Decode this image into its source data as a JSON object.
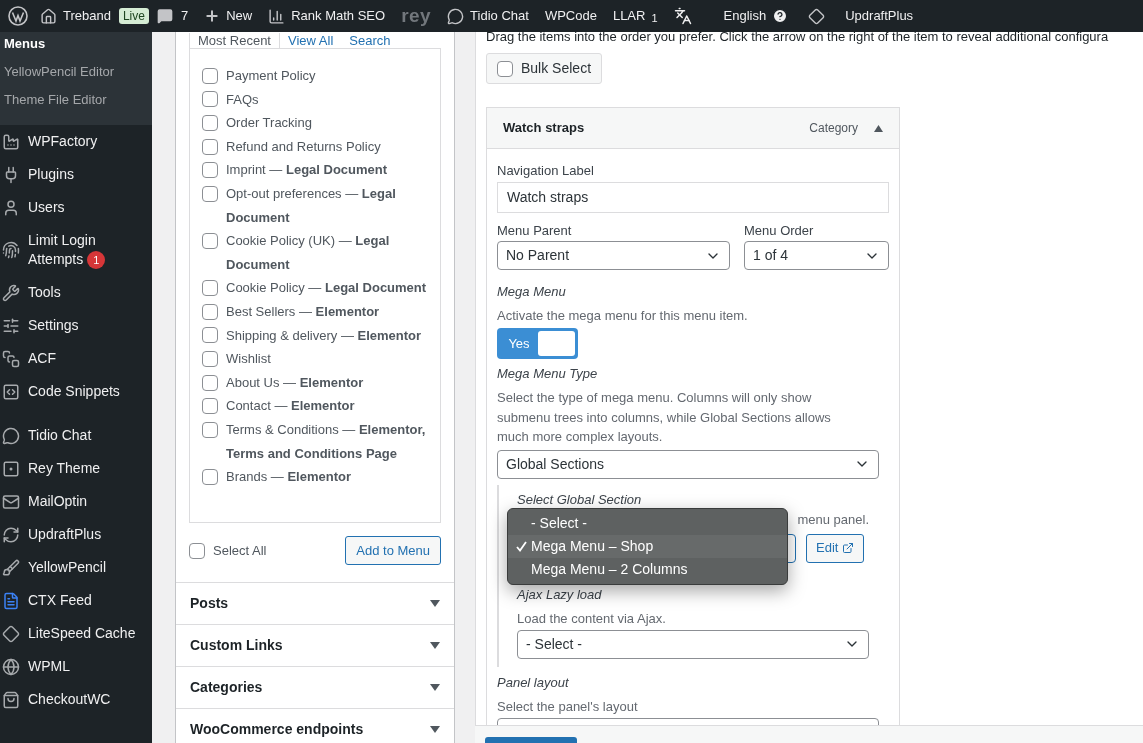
{
  "admin_bar": {
    "site_name": "Treband",
    "site_badge": "Live",
    "comments": "7",
    "new_label": "New",
    "items": [
      {
        "kind": "chart",
        "label": "Rank Math SEO"
      },
      {
        "kind": "logo",
        "label": "rey"
      },
      {
        "kind": "chat",
        "label": "Tidio Chat"
      },
      {
        "kind": "text",
        "label": "WPCode"
      },
      {
        "kind": "counter",
        "label": "LLAR",
        "count": "1"
      },
      {
        "kind": "translate"
      },
      {
        "kind": "language",
        "label": "English"
      },
      {
        "kind": "diamond"
      },
      {
        "kind": "text",
        "label": "UpdraftPlus"
      }
    ]
  },
  "sidebar": {
    "submenu": [
      {
        "label": "Menus",
        "selected": true
      },
      {
        "label": "YellowPencil Editor",
        "selected": false
      },
      {
        "label": "Theme File Editor",
        "selected": false
      }
    ],
    "groups": [
      [
        {
          "label": "WPFactory"
        },
        {
          "label": "Plugins"
        },
        {
          "label": "Users"
        },
        {
          "label": "Limit Login Attempts",
          "badge": "1"
        },
        {
          "label": "Tools"
        },
        {
          "label": "Settings"
        },
        {
          "label": "ACF"
        },
        {
          "label": "Code Snippets"
        }
      ],
      [
        {
          "label": "Tidio Chat"
        },
        {
          "label": "Rey Theme"
        },
        {
          "label": "MailOptin"
        },
        {
          "label": "UpdraftPlus"
        },
        {
          "label": "YellowPencil"
        },
        {
          "label": "CTX Feed"
        },
        {
          "label": "LiteSpeed Cache"
        },
        {
          "label": "WPML"
        },
        {
          "label": "CheckoutWC"
        }
      ]
    ]
  },
  "pages_box": {
    "tabs": [
      {
        "label": "Most Recent",
        "selected": true
      },
      {
        "label": "View All",
        "selected": false
      },
      {
        "label": "Search",
        "selected": false
      }
    ],
    "items": [
      {
        "label": "Payment Policy",
        "checked": false
      },
      {
        "label": "FAQs",
        "checked": false
      },
      {
        "label": "Order Tracking",
        "checked": false
      },
      {
        "label": "Refund and Returns Policy",
        "checked": false
      },
      {
        "label": "Imprint — **Legal Document**",
        "checked": false
      },
      {
        "label": "Opt-out preferences — **Legal Document**",
        "checked": false
      },
      {
        "label": "Cookie Policy (UK) — **Legal Document**",
        "checked": false
      },
      {
        "label": "Cookie Policy — **Legal Document**",
        "checked": false
      },
      {
        "label": "Best Sellers — **Elementor**",
        "checked": false
      },
      {
        "label": "Shipping & delivery — **Elementor**",
        "checked": false
      },
      {
        "label": "Wishlist",
        "checked": false
      },
      {
        "label": "About Us — **Elementor**",
        "checked": false
      },
      {
        "label": "Contact — **Elementor**",
        "checked": false
      },
      {
        "label": "Terms & Conditions — **Elementor, Terms and Conditions Page**",
        "checked": false
      },
      {
        "label": "Brands — **Elementor**",
        "checked": false
      }
    ],
    "select_all": {
      "label": "Select All",
      "checked": false
    },
    "add_button": "Add to Menu"
  },
  "sections": [
    "Posts",
    "Custom Links",
    "Categories",
    "WooCommerce endpoints"
  ],
  "menu_structure": {
    "intro": "Drag the items into the order you prefer. Click the arrow on the right of the item to reveal additional configura",
    "bulk_select": {
      "label": "Bulk Select",
      "checked": false
    },
    "item": {
      "title": "Watch straps",
      "type": "Category",
      "expanded": true,
      "nav_label": {
        "label": "Navigation Label",
        "value": "Watch straps"
      },
      "menu_parent": {
        "label": "Menu Parent",
        "value": "No Parent"
      },
      "menu_order": {
        "label": "Menu Order",
        "value": "1 of 4"
      },
      "mega_menu": {
        "title": "Mega Menu",
        "description": "Activate the mega menu for this menu item.",
        "toggle_label": "Yes",
        "on": true
      },
      "mega_menu_type": {
        "title": "Mega Menu Type",
        "description": "Select the type of mega menu. Columns will only show submenu trees into columns, while Global Sections allows much more complex layouts.",
        "value": "Global Sections"
      },
      "global_section": {
        "title": "Select Global Section",
        "description_visible": "menu panel.",
        "edit_button": "Edit",
        "options": [
          {
            "label": "- Select -",
            "selected": false
          },
          {
            "label": "Mega Menu – Shop",
            "selected": true
          },
          {
            "label": "Mega Menu – 2 Columns",
            "selected": false
          }
        ]
      },
      "ajax_lazy_load": {
        "title": "Ajax Lazy load",
        "description": "Load the content via Ajax.",
        "value": "- Select -"
      },
      "panel_layout": {
        "title": "Panel layout",
        "description": "Select the panel's layout"
      }
    }
  }
}
